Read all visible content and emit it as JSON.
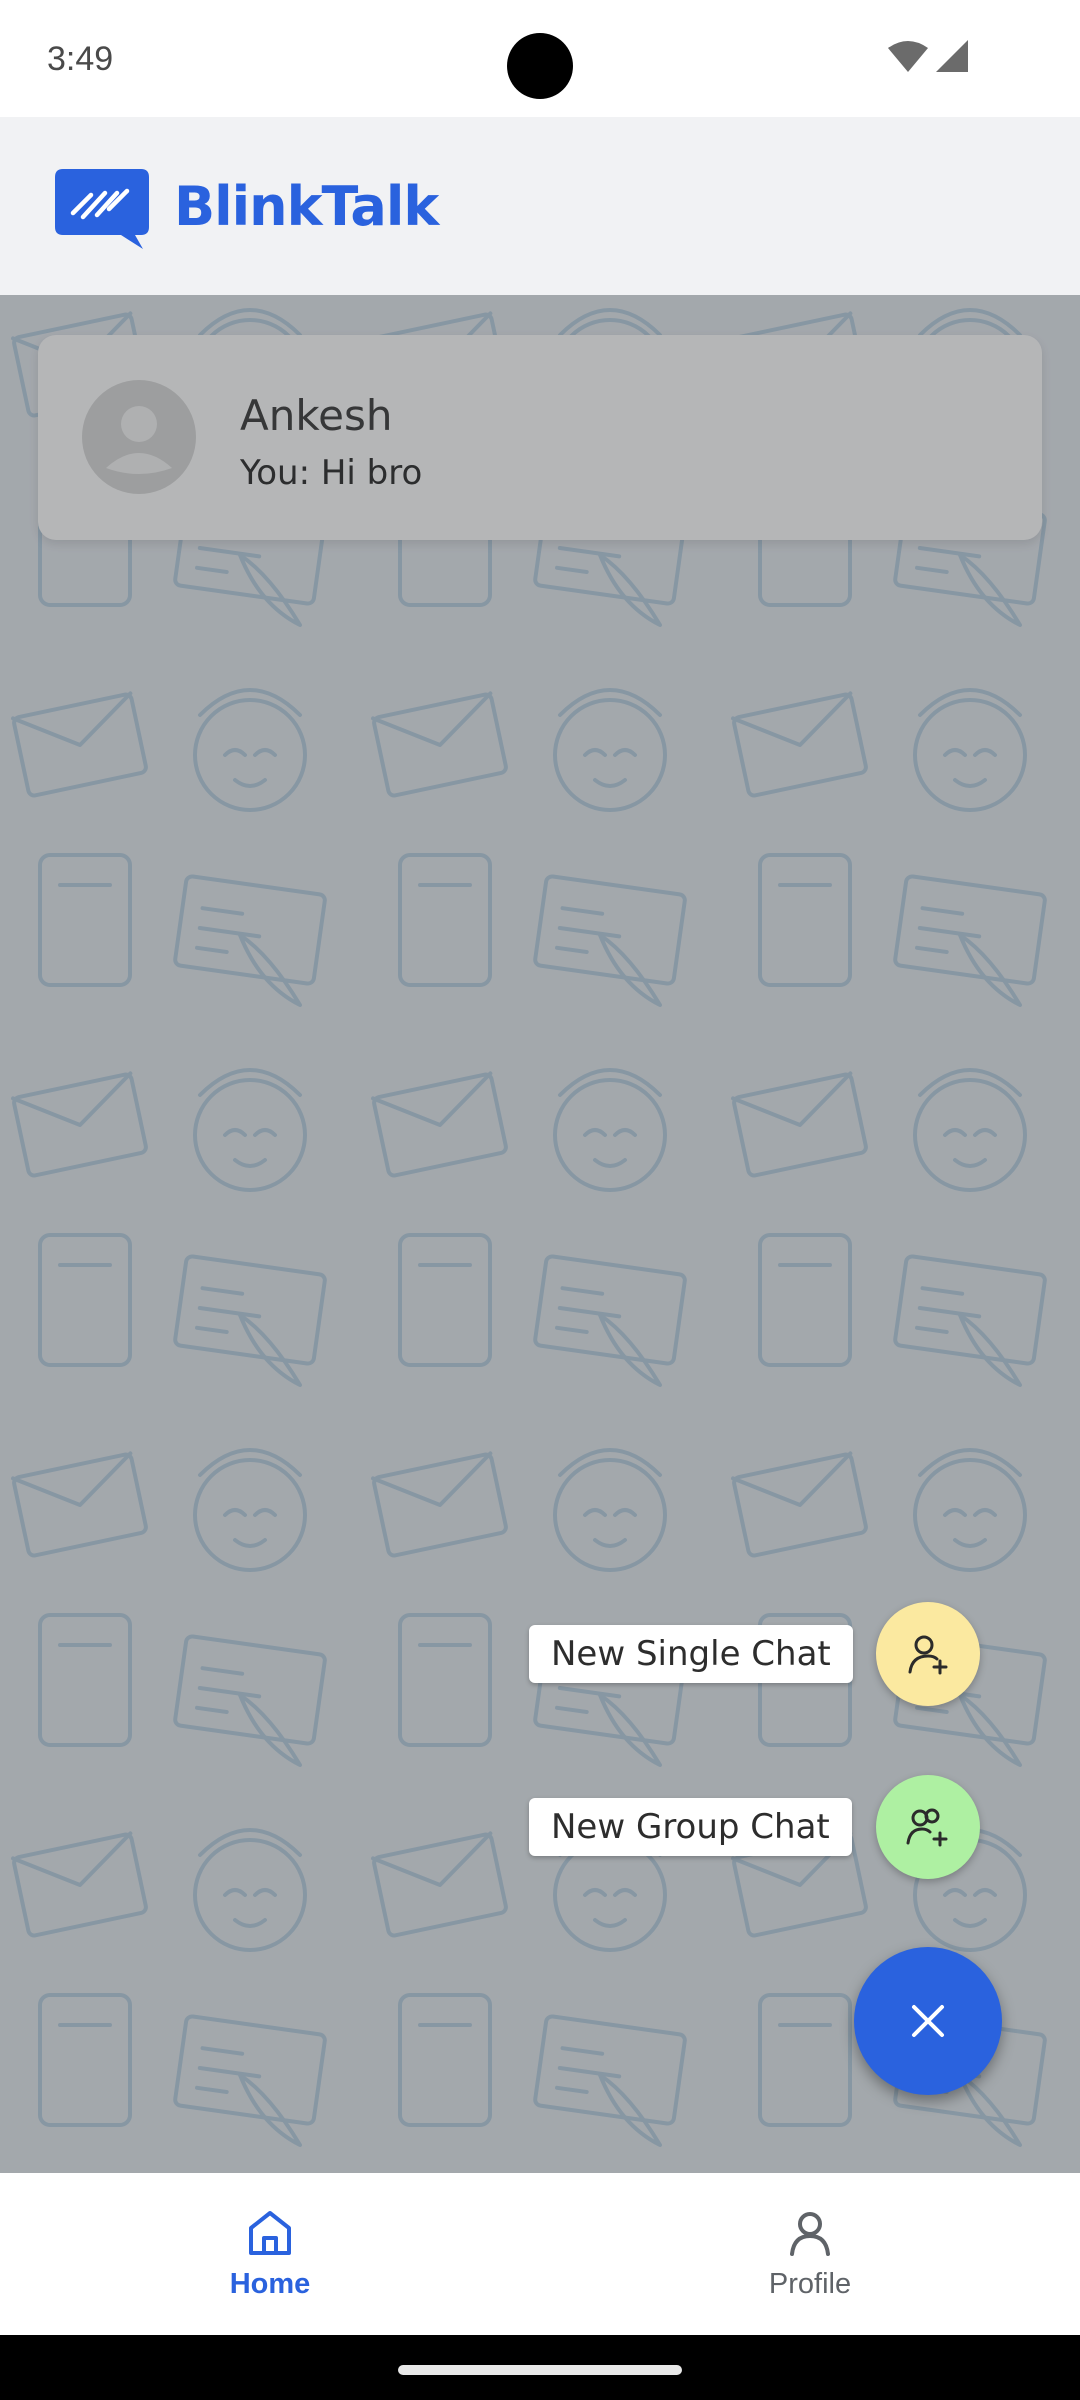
{
  "status_bar": {
    "time": "3:49",
    "icons": [
      "wifi-icon",
      "signal-icon"
    ]
  },
  "app_bar": {
    "title": "BlinkTalk",
    "logo": "blinktalk-logo",
    "brand_color": "#2a62de"
  },
  "chats": [
    {
      "name": "Ankesh",
      "preview": "You: Hi bro",
      "avatar": "default-avatar-icon"
    }
  ],
  "speed_dial": {
    "open": true,
    "actions": [
      {
        "label": "New Single Chat",
        "icon": "person-add-icon",
        "color": "#fbe9a0"
      },
      {
        "label": "New Group Chat",
        "icon": "group-add-icon",
        "color": "#aef0a2"
      }
    ],
    "main_icon": "close-icon",
    "main_color": "#2a62de"
  },
  "bottom_nav": {
    "items": [
      {
        "label": "Home",
        "icon": "home-icon",
        "active": true
      },
      {
        "label": "Profile",
        "icon": "profile-icon",
        "active": false
      }
    ]
  }
}
